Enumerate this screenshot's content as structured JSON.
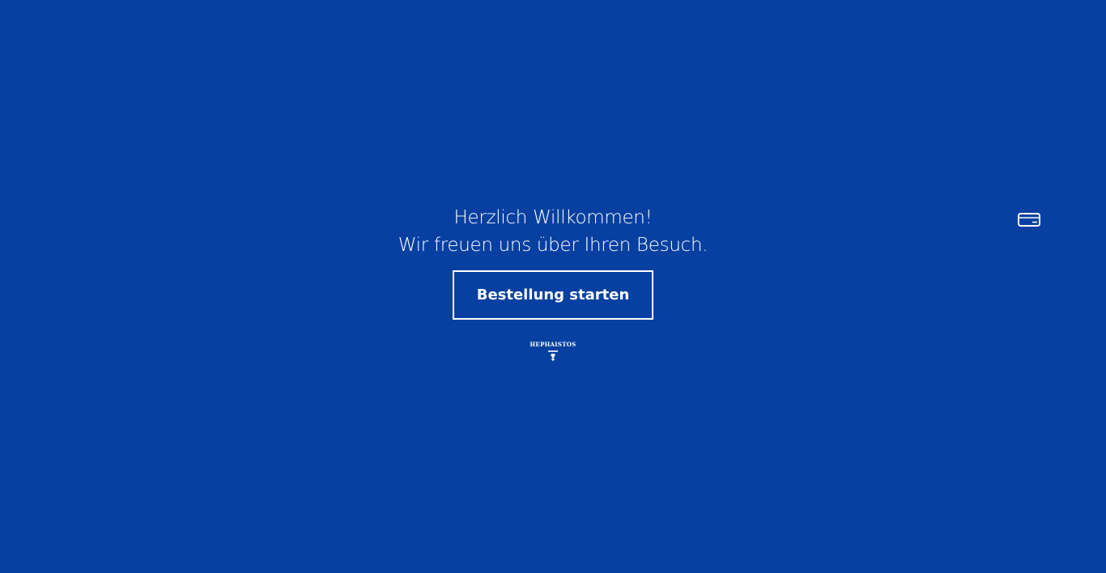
{
  "welcome": {
    "line1": "Herzlich Willkommen!",
    "line2": "Wir freuen uns über Ihren Besuch."
  },
  "start_button": {
    "label": "Bestellung starten"
  },
  "logo": {
    "text": "HEPHAISTOS"
  },
  "icons": {
    "card": "credit-card-icon"
  },
  "colors": {
    "background": "#0740a0",
    "foreground": "#ffffff"
  }
}
